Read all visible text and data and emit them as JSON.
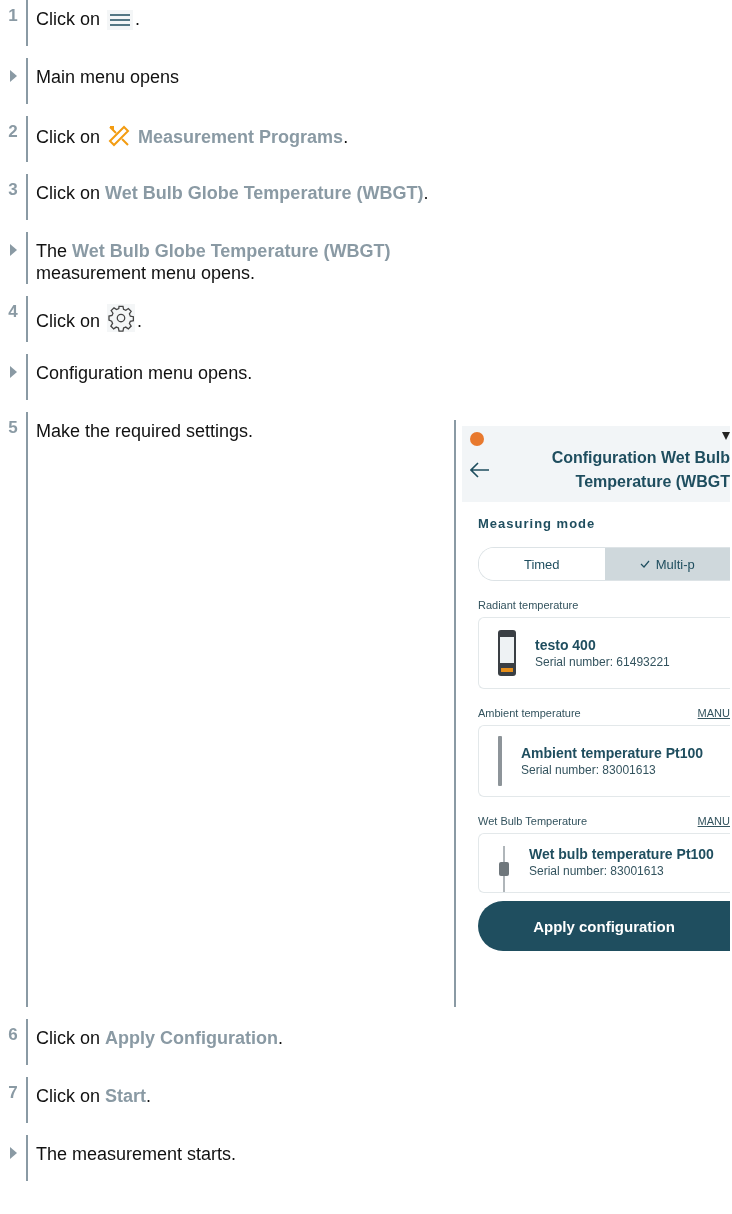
{
  "steps": [
    {
      "kind": "step",
      "number": "1",
      "segments": [
        {
          "kind": "text",
          "text": "Click on "
        },
        {
          "kind": "menu-icon"
        },
        {
          "kind": "text",
          "text": "."
        }
      ]
    },
    {
      "kind": "result",
      "segments": [
        {
          "kind": "text",
          "text": "Main menu opens"
        }
      ]
    },
    {
      "kind": "step",
      "number": "2",
      "segments": [
        {
          "kind": "text",
          "text": "Click on "
        },
        {
          "kind": "tools-icon"
        },
        {
          "kind": "text",
          "text": " **Measurement Programs**."
        }
      ]
    },
    {
      "kind": "step",
      "number": "3",
      "segments": [
        {
          "kind": "text",
          "text": "Click on **Wet Bulb Globe Temperature (WBGT)**."
        }
      ]
    },
    {
      "kind": "result",
      "segments": [
        {
          "kind": "text",
          "text": "The **Wet Bulb Globe Temperature (WBGT)** measurement menu opens."
        }
      ]
    },
    {
      "kind": "step",
      "number": "4",
      "segments": [
        {
          "kind": "text",
          "text": "Click on "
        },
        {
          "kind": "gear-icon"
        },
        {
          "kind": "text",
          "text": "."
        }
      ]
    },
    {
      "kind": "result",
      "segments": [
        {
          "kind": "text",
          "text": "Configuration menu opens."
        }
      ]
    },
    {
      "kind": "step",
      "number": "5",
      "segments": [
        {
          "kind": "text",
          "text": "Make the required settings."
        }
      ],
      "screenshot": {
        "title_lines": [
          "Configuration Wet Bulb",
          "Temperature (WBGT"
        ],
        "mode_label": "Measuring mode",
        "modes": [
          {
            "label": "Timed",
            "selected": false
          },
          {
            "label": "Multi-p",
            "selected": true
          }
        ],
        "sections": [
          {
            "label": "Radiant temperature",
            "device": {
              "kind": "handheld",
              "name": "testo 400",
              "serial": "Serial number: 61493221"
            }
          },
          {
            "label": "Ambient temperature",
            "link": "MANU",
            "device": {
              "kind": "probe",
              "name": "Ambient temperature Pt100",
              "serial": "Serial number: 83001613"
            }
          },
          {
            "label": "Wet Bulb Temperature",
            "link": "MANU",
            "device": {
              "kind": "bulb-probe",
              "name": "Wet bulb temperature Pt100",
              "serial": "Serial number: 83001613"
            }
          }
        ],
        "button": "Apply configuration"
      }
    },
    {
      "kind": "step",
      "number": "6",
      "segments": [
        {
          "kind": "text",
          "text": "Click on **Apply Configuration**."
        }
      ]
    },
    {
      "kind": "step",
      "number": "7",
      "segments": [
        {
          "kind": "text",
          "text": "Click on **Start**."
        }
      ]
    },
    {
      "kind": "result",
      "segments": [
        {
          "kind": "text",
          "text": "The measurement starts."
        }
      ]
    }
  ]
}
